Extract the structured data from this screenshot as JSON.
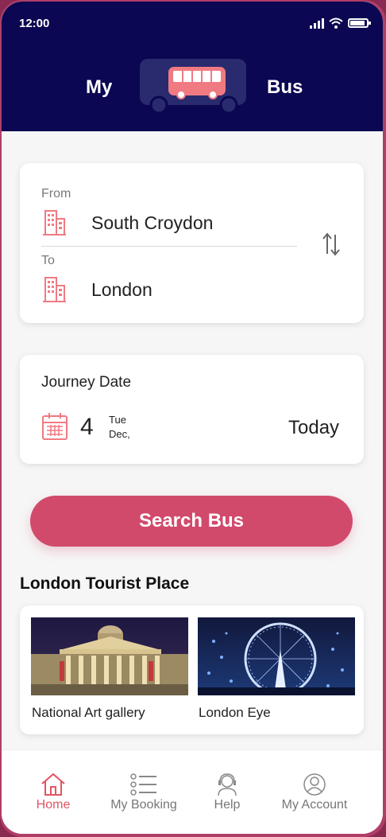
{
  "status_bar": {
    "time": "12:00"
  },
  "header": {
    "brand_left": "My",
    "brand_right": "Bus"
  },
  "route": {
    "from_label": "From",
    "from_city": "South Croydon",
    "to_label": "To",
    "to_city": "London"
  },
  "journey": {
    "label": "Journey Date",
    "day": "4",
    "weekday": "Tue",
    "month": "Dec,",
    "today_label": "Today"
  },
  "search_button": {
    "label": "Search Bus"
  },
  "tourist": {
    "title": "London Tourist Place",
    "places": [
      {
        "name": "National Art gallery"
      },
      {
        "name": "London Eye"
      }
    ]
  },
  "nav": {
    "items": [
      {
        "label": "Home",
        "icon": "home-icon",
        "active": true
      },
      {
        "label": "My Booking",
        "icon": "list-icon",
        "active": false
      },
      {
        "label": "Help",
        "icon": "support-icon",
        "active": false
      },
      {
        "label": "My Account",
        "icon": "account-icon",
        "active": false
      }
    ]
  },
  "colors": {
    "header_bg": "#0b0752",
    "accent": "#d14a6c",
    "active_nav": "#e15563",
    "icon_pink": "#f07a82"
  }
}
